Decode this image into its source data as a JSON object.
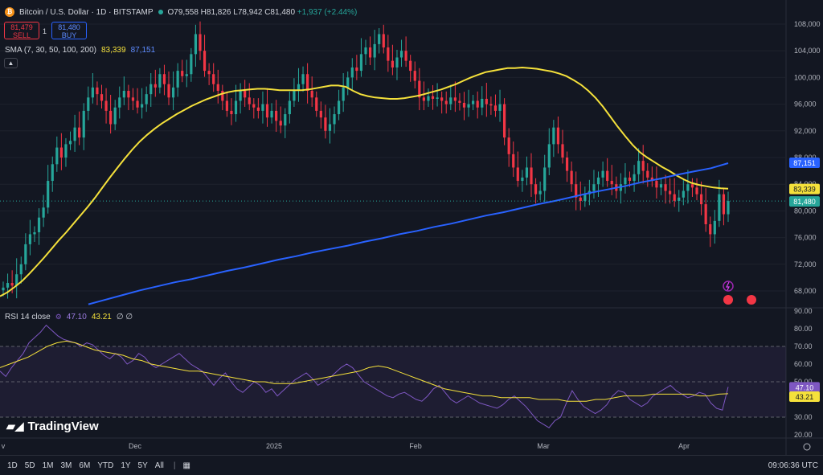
{
  "header": {
    "symbol_title": "Bitcoin / U.S. Dollar · 1D · BITSTAMP",
    "ohlc": {
      "o": "O79,558",
      "h": "H81,826",
      "l": "L78,942",
      "c": "C81,480",
      "change": "+1,937 (+2.44%)"
    },
    "sell_price": "81,479",
    "sell_label": "SELL",
    "spread": "1",
    "buy_price": "81,480",
    "buy_label": "BUY",
    "sma_label": "SMA (7, 30, 50, 100, 200)",
    "sma_v1": "83,339",
    "sma_v2": "87,151",
    "collapse_icon": "chevron-up-icon"
  },
  "rsi_legend": {
    "label": "RSI 14 close",
    "v1": "47.10",
    "v2": "43.21",
    "v3": "∅ ∅"
  },
  "price_axis": [
    "108,000",
    "104,000",
    "100,000",
    "96,000",
    "92,000",
    "88,000",
    "84,000",
    "80,000",
    "76,000",
    "72,000",
    "68,000"
  ],
  "rsi_axis": [
    "90.00",
    "80.00",
    "70.00",
    "60.00",
    "50.00",
    "40.00",
    "30.00",
    "20.00"
  ],
  "price_tags": {
    "sma200": "87,151",
    "sma50": "83,339",
    "last": "81,480",
    "rsi": "47.10",
    "rsi_ma": "43.21"
  },
  "time_axis": [
    {
      "label": "v"
    },
    {
      "label": "Dec"
    },
    {
      "label": "2025"
    },
    {
      "label": "Feb"
    },
    {
      "label": "Mar"
    },
    {
      "label": "Apr"
    }
  ],
  "bottom_bar": {
    "timeframes": [
      "1D",
      "5D",
      "1M",
      "3M",
      "6M",
      "YTD",
      "1Y",
      "5Y",
      "All"
    ],
    "clock": "09:06:36 UTC"
  },
  "logo_text": "TradingView",
  "colors": {
    "up": "#26a69a",
    "down": "#f23645",
    "sma_fast": "#f5e13b",
    "sma_slow": "#2962ff",
    "rsi": "#7e57c2",
    "rsi_ma": "#f5e13b"
  },
  "chart_data": [
    {
      "type": "candlestick",
      "title": "Bitcoin / U.S. Dollar · 1D · BITSTAMP",
      "ylim": [
        66000,
        110000
      ],
      "x_labels": [
        "Dec",
        "2025",
        "Feb",
        "Mar",
        "Apr"
      ],
      "closes": [
        68500,
        69200,
        68800,
        70500,
        72000,
        75000,
        76500,
        76800,
        79000,
        80500,
        84500,
        87000,
        89500,
        88000,
        90000,
        90500,
        92500,
        91000,
        95000,
        97000,
        98500,
        97500,
        96500,
        95000,
        93000,
        95500,
        97000,
        98000,
        97000,
        96500,
        95500,
        96000,
        97500,
        99000,
        98500,
        100500,
        99000,
        97000,
        98500,
        101000,
        100200,
        100500,
        103500,
        106500,
        104000,
        101000,
        100500,
        99000,
        98000,
        96500,
        95000,
        94500,
        96500,
        98000,
        97000,
        96000,
        95500,
        95000,
        96000,
        94000,
        95000,
        93500,
        92800,
        94500,
        96500,
        98000,
        99000,
        100500,
        98000,
        97000,
        95000,
        94000,
        92000,
        93000,
        94500,
        96500,
        98500,
        100000,
        101500,
        101000,
        103500,
        104500,
        103000,
        105000,
        106500,
        104500,
        102500,
        101500,
        103000,
        104000,
        102500,
        101000,
        99500,
        97000,
        96500,
        97200,
        96800,
        97000,
        96500,
        96000,
        97000,
        96500,
        96200,
        95500,
        96000,
        96500,
        95500,
        96800,
        96000,
        95800,
        95000,
        96000,
        91000,
        88500,
        86500,
        84500,
        85000,
        86500,
        84000,
        82500,
        83000,
        86500,
        90000,
        92500,
        90000,
        88000,
        86000,
        84000,
        82000,
        81500,
        82500,
        83000,
        84000,
        85000,
        86000,
        84500,
        84000,
        83000,
        84000,
        85000,
        84500,
        85500,
        87500,
        86000,
        85000,
        84500,
        83500,
        84000,
        83000,
        82500,
        81500,
        82000,
        83000,
        84000,
        83500,
        82500,
        81000,
        78000,
        76500,
        78500,
        82500,
        79500,
        81480
      ],
      "sma_fast": [
        67200,
        67800,
        68600,
        69500,
        70600,
        71800,
        73000,
        74300,
        75600,
        76800,
        78100,
        79400,
        80700,
        82100,
        83600,
        85100,
        86500,
        87900,
        89200,
        90400,
        91400,
        92300,
        93100,
        93800,
        94500,
        95100,
        95700,
        96200,
        96700,
        97100,
        97500,
        97800,
        98000,
        98100,
        98200,
        98300,
        98300,
        98200,
        98100,
        98100,
        98100,
        98100,
        98200,
        98400,
        98600,
        98800,
        98800,
        98600,
        98000,
        97500,
        97200,
        97000,
        96900,
        96800,
        96800,
        96900,
        97100,
        97300,
        97600,
        97900,
        98200,
        98600,
        99000,
        99500,
        100000,
        100400,
        100800,
        101000,
        101200,
        101400,
        101400,
        101500,
        101400,
        101300,
        101100,
        100900,
        100600,
        100200,
        99600,
        98900,
        98000,
        96900,
        95600,
        94100,
        92600,
        91200,
        89900,
        88800,
        88000,
        87300,
        86600,
        86000,
        85300,
        84700,
        84200,
        83900,
        83700,
        83500,
        83400,
        83339
      ],
      "sma_slow": [
        66000,
        66700,
        67400,
        68100,
        68700,
        69300,
        69800,
        70400,
        71000,
        71500,
        72100,
        72700,
        73200,
        73800,
        74300,
        74800,
        75400,
        75900,
        76500,
        77000,
        77600,
        78100,
        78700,
        79300,
        79800,
        80400,
        81000,
        81500,
        82100,
        82700,
        83200,
        83700,
        84300,
        84800,
        85400,
        85900,
        86400,
        87151
      ],
      "rsi": [
        56,
        53,
        58,
        62,
        66,
        72,
        75,
        78,
        82,
        79,
        76,
        74,
        73,
        72,
        70,
        72,
        71,
        68,
        65,
        63,
        66,
        64,
        60,
        62,
        66,
        64,
        60,
        58,
        60,
        62,
        64,
        66,
        63,
        60,
        58,
        56,
        52,
        48,
        52,
        55,
        50,
        46,
        44,
        47,
        50,
        48,
        44,
        46,
        42,
        45,
        48,
        51,
        53,
        55,
        52,
        48,
        50,
        52,
        55,
        58,
        60,
        58,
        54,
        50,
        48,
        46,
        44,
        42,
        41,
        43,
        44,
        42,
        40,
        39,
        42,
        46,
        48,
        44,
        40,
        38,
        40,
        42,
        40,
        38,
        37,
        36,
        35,
        37,
        40,
        42,
        39,
        36,
        32,
        28,
        26,
        24,
        28,
        30,
        38,
        45,
        40,
        36,
        34,
        32,
        34,
        37,
        42,
        45,
        44,
        40,
        38,
        36,
        38,
        42,
        44,
        46,
        48,
        45,
        43,
        41,
        42,
        44,
        43,
        38,
        35,
        34,
        47.1
      ],
      "rsi_ma": [
        58,
        60,
        62,
        64,
        67,
        70,
        72,
        73,
        72,
        70,
        68,
        67,
        66,
        65,
        63,
        62,
        60,
        59,
        58,
        57,
        56,
        56,
        55,
        54,
        53,
        52,
        51,
        50,
        50,
        49,
        49,
        49,
        50,
        51,
        52,
        53,
        54,
        55,
        56,
        58,
        59,
        58,
        56,
        54,
        52,
        50,
        48,
        46,
        45,
        44,
        43,
        42,
        42,
        41,
        41,
        41,
        41,
        40,
        40,
        40,
        39,
        39,
        39,
        40,
        40,
        41,
        42,
        42,
        42,
        43,
        43,
        43,
        43,
        43,
        42,
        42,
        43,
        43.21
      ]
    }
  ]
}
